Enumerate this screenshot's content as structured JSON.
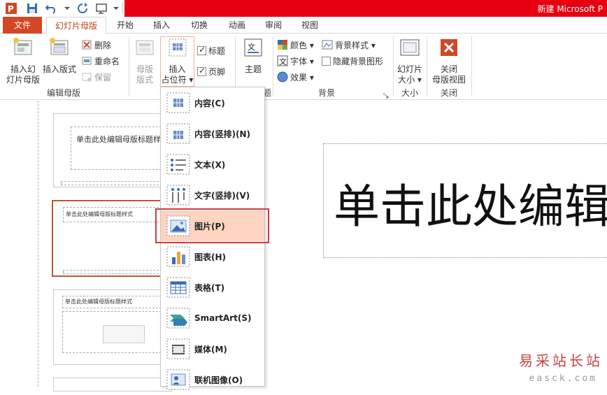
{
  "window": {
    "title": "新建 Microsoft P"
  },
  "tabs": {
    "file": "文件",
    "items": [
      {
        "label": "幻灯片母版"
      },
      {
        "label": "开始"
      },
      {
        "label": "插入"
      },
      {
        "label": "切换"
      },
      {
        "label": "动画"
      },
      {
        "label": "审阅"
      },
      {
        "label": "视图"
      }
    ]
  },
  "ribbon": {
    "edit_master": {
      "insert_slide_master": "插入幻\n灯片母版",
      "insert_layout": "插入版式",
      "delete": "删除",
      "rename": "重命名",
      "preserve": "保留",
      "group_label": "编辑母版"
    },
    "master_layout": {
      "master_layout": "母版\n版式",
      "insert_placeholder": "插入\n占位符 ▾",
      "title_check": "标题",
      "footer_check": "页脚"
    },
    "edit_theme": {
      "theme": "主题",
      "group_label_tail": "题"
    },
    "background": {
      "colors": "颜色 ▾",
      "fonts": "字体 ▾",
      "effects": "效果 ▾",
      "background_styles": "背景样式 ▾",
      "hide_background": "隐藏背景图形",
      "group_label": "背景"
    },
    "size": {
      "slide_size": "幻灯片\n大小 ▾",
      "group_label": "大小"
    },
    "close": {
      "close_master": "关闭\n母版视图",
      "group_label": "关闭"
    }
  },
  "dropdown": {
    "items": [
      {
        "label": "内容(C)",
        "icon": "content-placeholder-icon"
      },
      {
        "label": "内容(竖排)(N)",
        "icon": "vertical-content-placeholder-icon"
      },
      {
        "label": "文本(X)",
        "icon": "text-placeholder-icon"
      },
      {
        "label": "文字(竖排)(V)",
        "icon": "vertical-text-placeholder-icon"
      },
      {
        "label": "图片(P)",
        "icon": "picture-placeholder-icon"
      },
      {
        "label": "图表(H)",
        "icon": "chart-placeholder-icon"
      },
      {
        "label": "表格(T)",
        "icon": "table-placeholder-icon"
      },
      {
        "label": "SmartArt(S)",
        "icon": "smartart-placeholder-icon"
      },
      {
        "label": "媒体(M)",
        "icon": "media-placeholder-icon"
      },
      {
        "label": "联机图像(O)",
        "icon": "online-image-placeholder-icon"
      }
    ],
    "highlighted": "图片(P)"
  },
  "thumbnails": {
    "slide1_title": "单击此处编辑母版标题样式",
    "slide2_title": "单击此处编辑母版标题样式",
    "slide3_title": "单击此处编辑母版标题样式"
  },
  "canvas": {
    "title_placeholder": "单击此处编辑"
  },
  "watermark": {
    "text": "易采站长站",
    "sub": "easck.com"
  },
  "colors": {
    "accent": "#d24726",
    "titlebar": "#e60012",
    "highlight": "#fcd4bf",
    "frame": "#d0383f"
  }
}
